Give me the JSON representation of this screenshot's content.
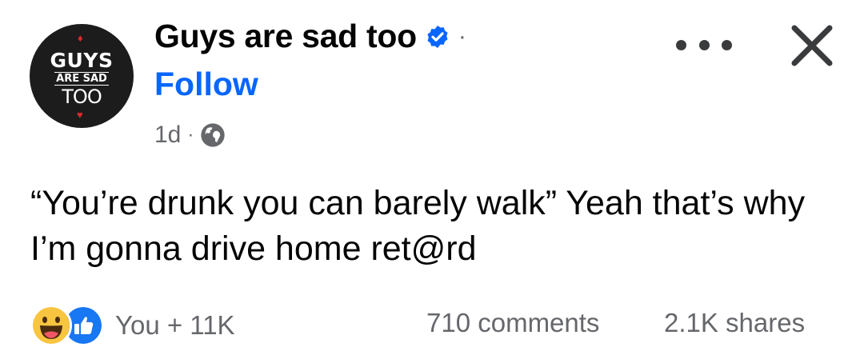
{
  "header": {
    "page_name": "Guys are sad too",
    "follow_label": "Follow",
    "time": "1d",
    "avatar_text": {
      "line1": "GUYS",
      "line2": "ARE SAD",
      "line3": "TOO"
    }
  },
  "post": {
    "text": "“You’re drunk you can barely walk” Yeah that’s why I’m gonna drive home ret@rd"
  },
  "footer": {
    "reactions_text": "You + 11K",
    "comments": "710 comments",
    "shares": "2.1K shares"
  },
  "colors": {
    "accent": "#0866ff",
    "secondary_text": "#65676b",
    "like_blue": "#1877f2",
    "haha_yellow": "#f7c53f"
  },
  "icons": [
    "verified-badge-icon",
    "globe-icon",
    "more-options-icon",
    "close-icon",
    "haha-reaction-icon",
    "like-reaction-icon"
  ]
}
